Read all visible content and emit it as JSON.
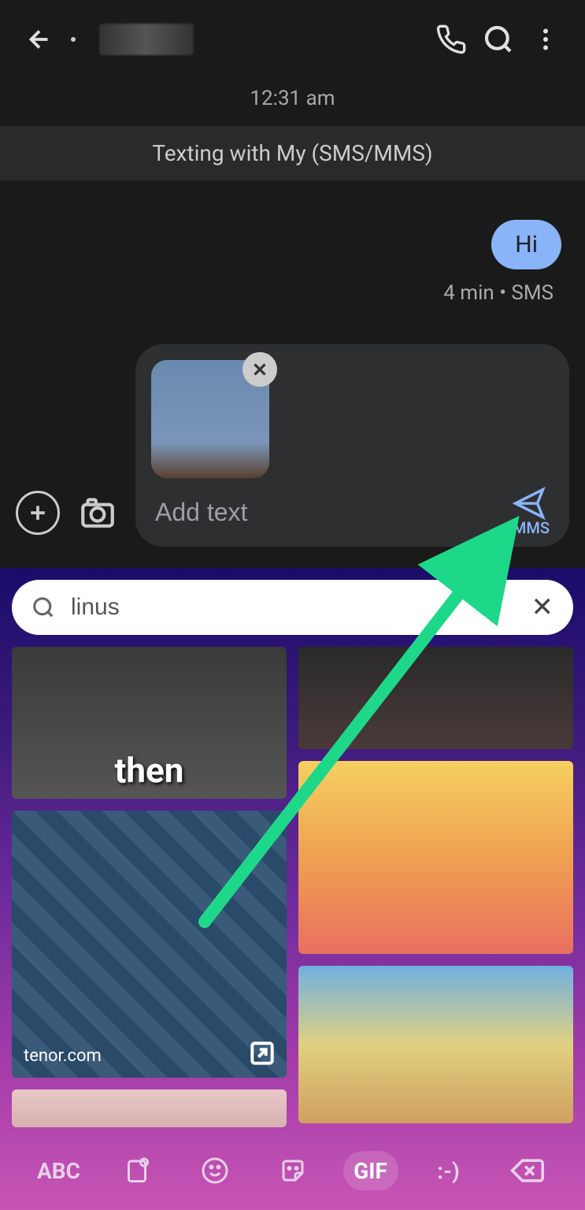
{
  "header": {
    "timestamp": "12:31 am"
  },
  "banner": {
    "text": "Texting with My (SMS/MMS)"
  },
  "messages": {
    "outgoing": "Hi",
    "meta": "4 min • SMS"
  },
  "compose": {
    "placeholder": "Add text",
    "send_label": "MMS"
  },
  "gif_search": {
    "query": "linus",
    "attribution": "tenor.com",
    "caption_1": "then"
  },
  "keyboard": {
    "abc": "ABC",
    "gif": "GIF",
    "text_face": ":-)"
  }
}
